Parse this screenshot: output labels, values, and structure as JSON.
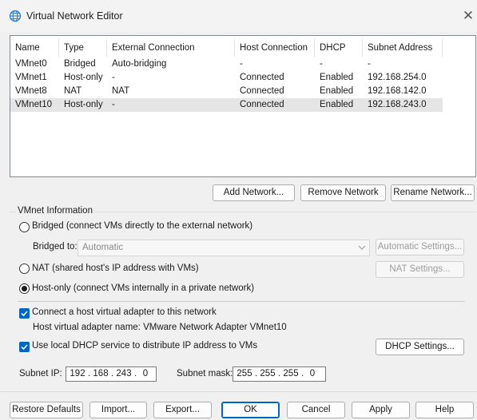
{
  "window": {
    "title": "Virtual Network Editor",
    "close_glyph": "✕",
    "icon": "globe-network-icon"
  },
  "table": {
    "columns": [
      "Name",
      "Type",
      "External Connection",
      "Host Connection",
      "DHCP",
      "Subnet Address"
    ],
    "rows": [
      [
        "VMnet0",
        "Bridged",
        "Auto-bridging",
        "-",
        "-",
        "-"
      ],
      [
        "VMnet1",
        "Host-only",
        "-",
        "Connected",
        "Enabled",
        "192.168.254.0"
      ],
      [
        "VMnet8",
        "NAT",
        "NAT",
        "Connected",
        "Enabled",
        "192.168.142.0"
      ],
      [
        "VMnet10",
        "Host-only",
        "-",
        "Connected",
        "Enabled",
        "192.168.243.0"
      ]
    ],
    "selected_row": 3
  },
  "table_buttons": {
    "add": "Add Network...",
    "remove": "Remove Network",
    "rename": "Rename Network..."
  },
  "vmnet_info": {
    "group_label": "VMnet Information",
    "bridged_label": "Bridged (connect VMs directly to the external network)",
    "bridged_to_label": "Bridged to:",
    "bridged_to_value": "Automatic",
    "automatic_settings": "Automatic Settings...",
    "nat_label": "NAT (shared host's IP address with VMs)",
    "nat_settings": "NAT Settings...",
    "hostonly_label": "Host-only (connect VMs internally in a private network)",
    "selected_mode": "host-only",
    "connect_adapter_label": "Connect a host virtual adapter to this network",
    "connect_adapter_checked": true,
    "adapter_name_text": "Host virtual adapter name: VMware Network Adapter VMnet10",
    "dhcp_label": "Use local DHCP service to distribute IP address to VMs",
    "dhcp_checked": true,
    "dhcp_settings": "DHCP Settings...",
    "subnet_ip_label": "Subnet IP:",
    "subnet_ip": [
      "192",
      "168",
      "243",
      "0"
    ],
    "subnet_mask_label": "Subnet mask:",
    "subnet_mask": [
      "255",
      "255",
      "255",
      "0"
    ]
  },
  "footer": {
    "restore": "Restore Defaults",
    "import": "Import...",
    "export": "Export...",
    "ok": "OK",
    "cancel": "Cancel",
    "apply": "Apply",
    "help": "Help"
  },
  "colors": {
    "accent": "#0067c0",
    "selected_row": "#e5e5e5",
    "disabled_text": "#9d9d9d"
  }
}
